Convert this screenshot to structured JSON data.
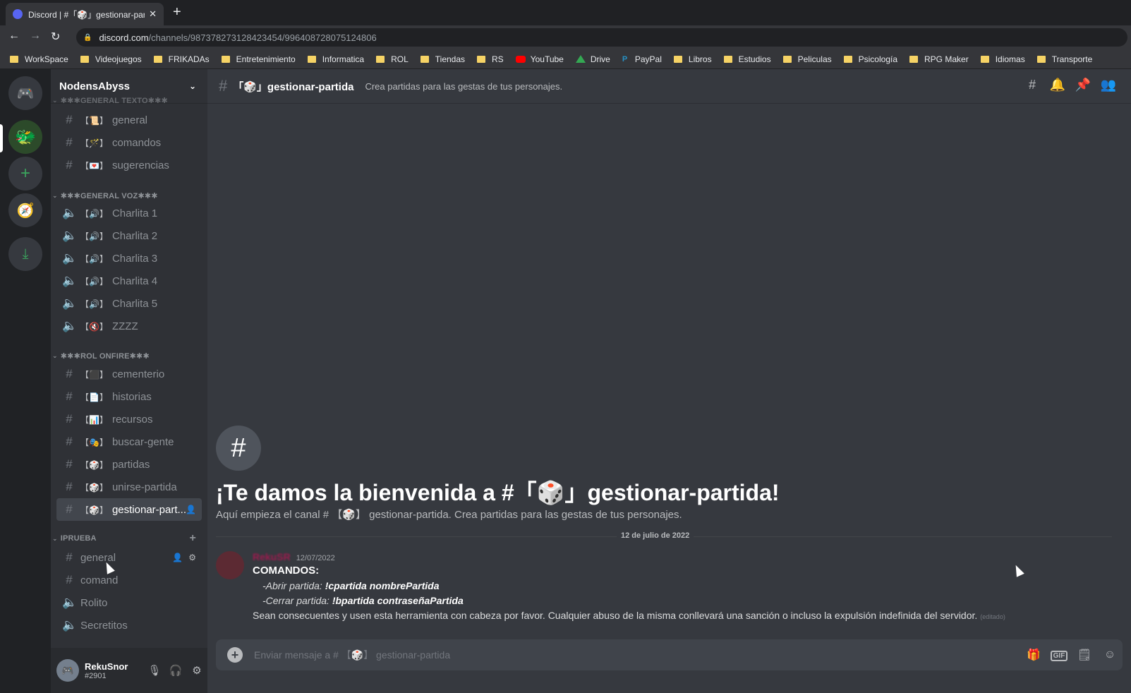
{
  "browser": {
    "tab_title": "Discord | #「🎲」gestionar-partida",
    "tab_close": "✕",
    "new_tab": "+",
    "url_domain": "discord.com",
    "url_path": "/channels/987378273128423454/996408728075124806",
    "bookmarks": [
      "WorkSpace",
      "Videojuegos",
      "FRIKADAs",
      "Entretenimiento",
      "Informatica",
      "ROL",
      "Tiendas",
      "RS",
      "YouTube",
      "Drive",
      "PayPal",
      "Libros",
      "Estudios",
      "Peliculas",
      "Psicología",
      "RPG Maker",
      "Idiomas",
      "Transporte"
    ]
  },
  "server": {
    "name": "NodensAbyss",
    "categories": {
      "texto": "✱✱✱GENERAL TEXTO✱✱✱",
      "voz": "✱✱✱GENERAL VOZ✱✱✱",
      "rol": "✱✱✱ROL ONFIRE✱✱✱",
      "prueba": "IPRUEBA"
    },
    "text_channels": [
      {
        "emoji": "【📜】",
        "name": "general"
      },
      {
        "emoji": "【🪄】",
        "name": "comandos"
      },
      {
        "emoji": "【💌】",
        "name": "sugerencias"
      }
    ],
    "voice_channels": [
      {
        "emoji": "【🔊】",
        "name": "Charlita 1"
      },
      {
        "emoji": "【🔊】",
        "name": "Charlita 2"
      },
      {
        "emoji": "【🔊】",
        "name": "Charlita 3"
      },
      {
        "emoji": "【🔊】",
        "name": "Charlita 4"
      },
      {
        "emoji": "【🔊】",
        "name": "Charlita 5"
      },
      {
        "emoji": "【🔇】",
        "name": "ZZZZ"
      }
    ],
    "rol_channels": [
      {
        "emoji": "【⬛】",
        "name": "cementerio"
      },
      {
        "emoji": "【📄】",
        "name": "historias"
      },
      {
        "emoji": "【📊】",
        "name": "recursos"
      },
      {
        "emoji": "【🎭】",
        "name": "buscar-gente"
      },
      {
        "emoji": "【🎲】",
        "name": "partidas"
      },
      {
        "emoji": "【🎲】",
        "name": "unirse-partida"
      },
      {
        "emoji": "【🎲】",
        "name": "gestionar-part..."
      }
    ],
    "prueba_channels": [
      {
        "name": "general"
      },
      {
        "name": "comand"
      },
      {
        "name": "Rolito"
      },
      {
        "name": "Secretitos"
      }
    ]
  },
  "user": {
    "name": "RekuSnor",
    "tag": "#2901"
  },
  "channel": {
    "name": "「🎲」gestionar-partida",
    "topic": "Crea partidas para las gestas de tus personajes."
  },
  "welcome": {
    "title": "¡Te damos la bienvenida a #「🎲」gestionar-partida!",
    "subtitle": "Aquí empieza el canal # 【🎲】 gestionar-partida. Crea partidas para las gestas de tus personajes."
  },
  "date_divider": "12 de julio de 2022",
  "message": {
    "author": "RekuSR",
    "timestamp": "12/07/2022",
    "heading": "COMANDOS:",
    "open_label": "-Abrir partida: ",
    "open_cmd": "!cpartida nombrePartida",
    "close_label": "-Cerrar partida: ",
    "close_cmd": "!bpartida contraseñaPartida",
    "body": "Sean consecuentes y usen esta herramienta con cabeza por favor. Cualquier abuso de la misma conllevará una sanción o incluso la expulsión indefinida del servidor.",
    "edited": "(editado)"
  },
  "composer": {
    "placeholder": "Enviar mensaje a # 【🎲】 gestionar-partida",
    "gif": "GIF"
  },
  "colors": {
    "accent": "#5865f2",
    "green": "#3ba55d",
    "background": "#36393f",
    "sidebar": "#2f3136"
  }
}
